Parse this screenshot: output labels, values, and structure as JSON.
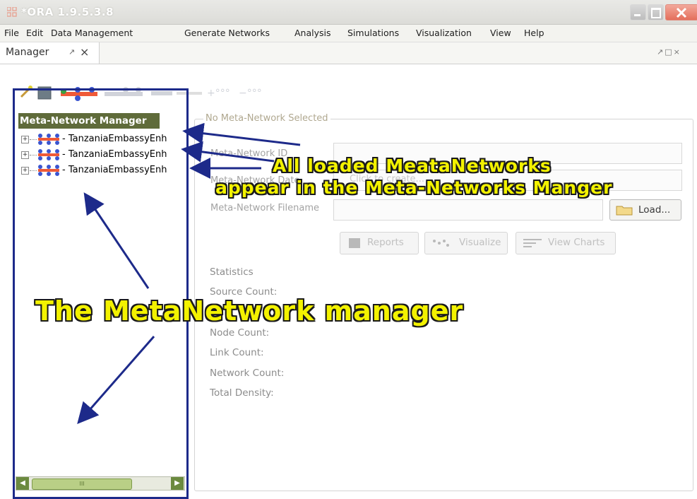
{
  "window": {
    "title": "*ORA 1.9.5.3.8"
  },
  "menu": [
    "File",
    "Edit",
    "Data Management",
    "Generate Networks",
    "Analysis",
    "Simulations",
    "Visualization",
    "View",
    "Help"
  ],
  "tab": {
    "label": "Manager"
  },
  "left_panel": {
    "header": "Meta-Network Manager",
    "tree_items": [
      "TanzaniaEmbassyEnh",
      "TanzaniaEmbassyEnh",
      "TanzaniaEmbassyEnh"
    ],
    "scroll_thumb": "III"
  },
  "right_panel": {
    "group_title": "No Meta-Network Selected",
    "fields": {
      "id_label": "Meta-Network ID",
      "date_label": "Meta-Network Date",
      "date_placeholder": "Click to create...",
      "filename_label": "Meta-Network Filename"
    },
    "load_button": "Load...",
    "buttons": {
      "reports": "Reports",
      "visualize": "Visualize",
      "view_charts": "View Charts"
    },
    "statistics": {
      "heading": "Statistics",
      "labels": [
        "Source Count:",
        "Node Count:",
        "Link Count:",
        "Network Count:",
        "Total Density:"
      ]
    }
  },
  "annotations": {
    "line1": "All loaded MeataNetworks",
    "line2": "appear in the Meta-Networks Manger",
    "big": "The MetaNetwork manager"
  },
  "colors": {
    "frame_blue": "#1d2a8a",
    "callout_yellow": "#f3f200",
    "header_olive": "#5f6b3a"
  }
}
